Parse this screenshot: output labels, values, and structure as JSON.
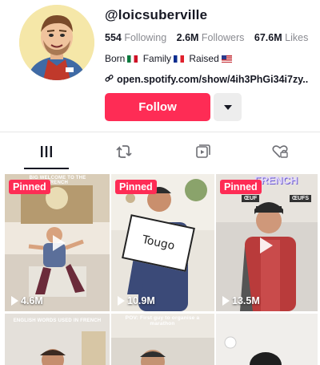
{
  "profile": {
    "handle": "@loicsuberville",
    "following_count": "554",
    "following_label": "Following",
    "followers_count": "2.6M",
    "followers_label": "Followers",
    "likes_count": "67.6M",
    "likes_label": "Likes",
    "bio": {
      "born": "Born",
      "family": "Family",
      "raised": "Raised"
    },
    "link": "open.spotify.com/show/4ih3PhGi34i7zy.."
  },
  "actions": {
    "follow_label": "Follow"
  },
  "tabs": [
    {
      "name": "videos",
      "icon": "grid-icon",
      "active": true
    },
    {
      "name": "reposts",
      "icon": "repost-icon",
      "active": false
    },
    {
      "name": "playlists",
      "icon": "playlist-icon",
      "active": false
    },
    {
      "name": "liked",
      "icon": "liked-heart-icon",
      "active": false
    }
  ],
  "videos": [
    {
      "pinned_label": "Pinned",
      "views": "4.6M",
      "caption": "BIG WELCOME TO THE FRENCH"
    },
    {
      "pinned_label": "Pinned",
      "views": "10.9M",
      "card_text": "Tougo"
    },
    {
      "pinned_label": "Pinned",
      "views": "13.5M",
      "overlay": "FRENCH",
      "tag1": "ŒUF",
      "tag2": "ŒUFS"
    },
    {
      "caption": "ENGLISH WORDS USED IN FRENCH"
    },
    {
      "caption": "POV: First guy to organise a marathon"
    },
    {}
  ],
  "colors": {
    "accent": "#fe2c55",
    "text": "#161823",
    "muted": "#8a8b91"
  }
}
